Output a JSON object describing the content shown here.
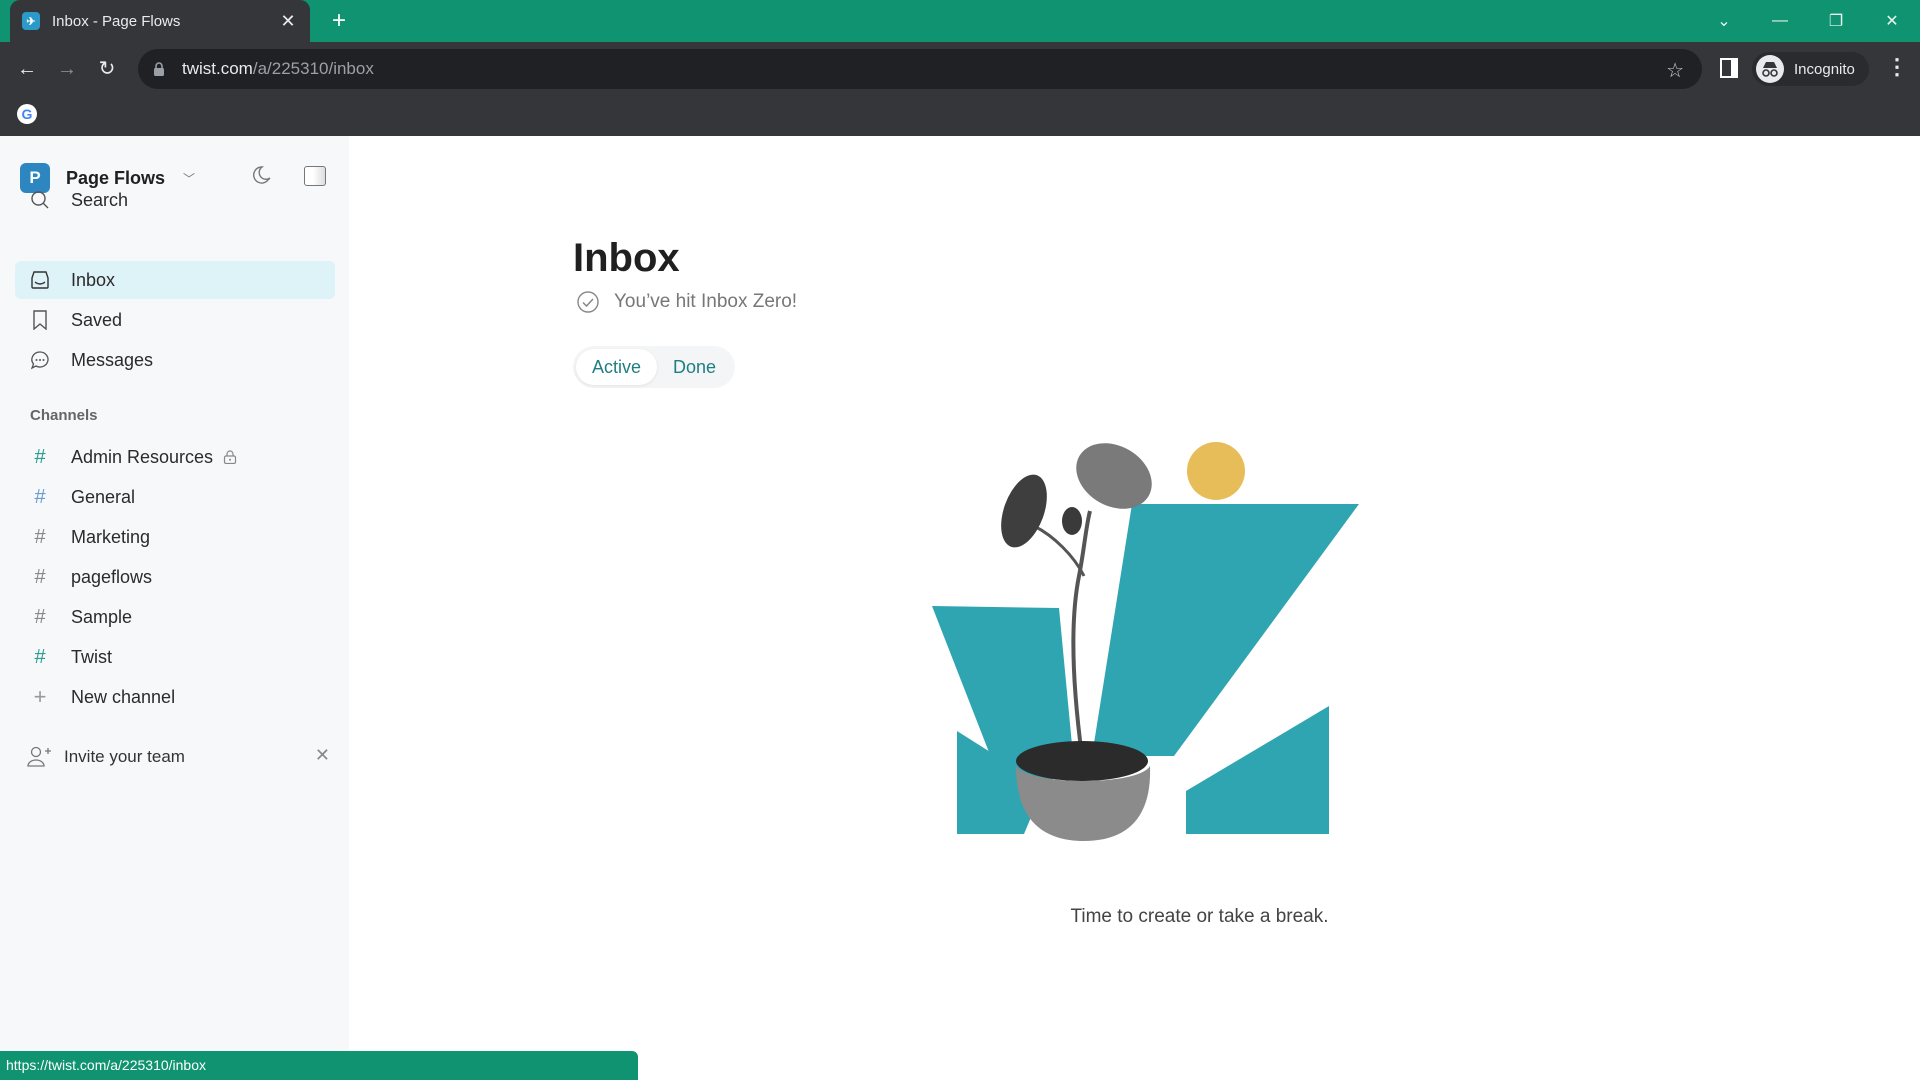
{
  "browser": {
    "tab_title": "Inbox - Page Flows",
    "url_host": "twist.com",
    "url_path": "/a/225310/inbox",
    "profile_label": "Incognito",
    "status_url": "https://twist.com/a/225310/inbox",
    "accent_color": "#0f9370"
  },
  "workspace": {
    "initial": "P",
    "name": "Page Flows"
  },
  "sidebar": {
    "nav": [
      {
        "label": "Search",
        "icon": "search-icon",
        "active": false
      },
      {
        "label": "Inbox",
        "icon": "inbox-icon",
        "active": true
      },
      {
        "label": "Saved",
        "icon": "bookmark-icon",
        "active": false
      },
      {
        "label": "Messages",
        "icon": "chat-icon",
        "active": false
      }
    ],
    "channels_heading": "Channels",
    "channels": [
      {
        "name": "Admin Resources",
        "private": true
      },
      {
        "name": "General",
        "private": false
      },
      {
        "name": "Marketing",
        "private": false
      },
      {
        "name": "pageflows",
        "private": false
      },
      {
        "name": "Sample",
        "private": false
      },
      {
        "name": "Twist",
        "private": false
      }
    ],
    "new_channel_label": "New channel",
    "invite_label": "Invite your team"
  },
  "main": {
    "title": "Inbox",
    "zero_message": "You’ve hit Inbox Zero!",
    "tabs": [
      {
        "label": "Active",
        "active": true
      },
      {
        "label": "Done",
        "active": false
      }
    ],
    "empty_message": "Time to create or take a break."
  }
}
